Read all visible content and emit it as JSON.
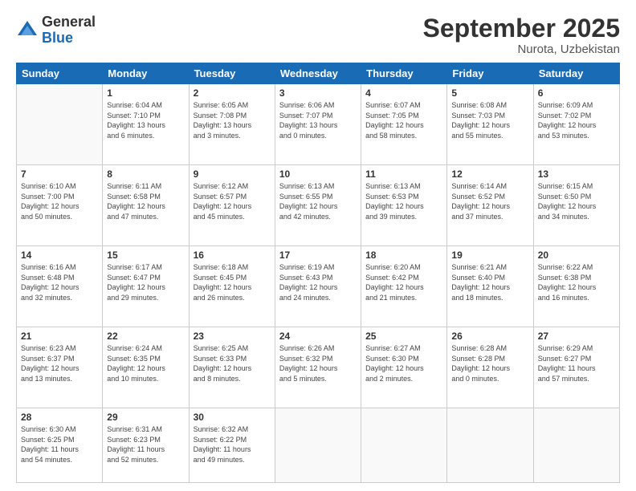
{
  "logo": {
    "general": "General",
    "blue": "Blue"
  },
  "header": {
    "month": "September 2025",
    "location": "Nurota, Uzbekistan"
  },
  "weekdays": [
    "Sunday",
    "Monday",
    "Tuesday",
    "Wednesday",
    "Thursday",
    "Friday",
    "Saturday"
  ],
  "weeks": [
    [
      {
        "day": "",
        "info": ""
      },
      {
        "day": "1",
        "info": "Sunrise: 6:04 AM\nSunset: 7:10 PM\nDaylight: 13 hours\nand 6 minutes."
      },
      {
        "day": "2",
        "info": "Sunrise: 6:05 AM\nSunset: 7:08 PM\nDaylight: 13 hours\nand 3 minutes."
      },
      {
        "day": "3",
        "info": "Sunrise: 6:06 AM\nSunset: 7:07 PM\nDaylight: 13 hours\nand 0 minutes."
      },
      {
        "day": "4",
        "info": "Sunrise: 6:07 AM\nSunset: 7:05 PM\nDaylight: 12 hours\nand 58 minutes."
      },
      {
        "day": "5",
        "info": "Sunrise: 6:08 AM\nSunset: 7:03 PM\nDaylight: 12 hours\nand 55 minutes."
      },
      {
        "day": "6",
        "info": "Sunrise: 6:09 AM\nSunset: 7:02 PM\nDaylight: 12 hours\nand 53 minutes."
      }
    ],
    [
      {
        "day": "7",
        "info": "Sunrise: 6:10 AM\nSunset: 7:00 PM\nDaylight: 12 hours\nand 50 minutes."
      },
      {
        "day": "8",
        "info": "Sunrise: 6:11 AM\nSunset: 6:58 PM\nDaylight: 12 hours\nand 47 minutes."
      },
      {
        "day": "9",
        "info": "Sunrise: 6:12 AM\nSunset: 6:57 PM\nDaylight: 12 hours\nand 45 minutes."
      },
      {
        "day": "10",
        "info": "Sunrise: 6:13 AM\nSunset: 6:55 PM\nDaylight: 12 hours\nand 42 minutes."
      },
      {
        "day": "11",
        "info": "Sunrise: 6:13 AM\nSunset: 6:53 PM\nDaylight: 12 hours\nand 39 minutes."
      },
      {
        "day": "12",
        "info": "Sunrise: 6:14 AM\nSunset: 6:52 PM\nDaylight: 12 hours\nand 37 minutes."
      },
      {
        "day": "13",
        "info": "Sunrise: 6:15 AM\nSunset: 6:50 PM\nDaylight: 12 hours\nand 34 minutes."
      }
    ],
    [
      {
        "day": "14",
        "info": "Sunrise: 6:16 AM\nSunset: 6:48 PM\nDaylight: 12 hours\nand 32 minutes."
      },
      {
        "day": "15",
        "info": "Sunrise: 6:17 AM\nSunset: 6:47 PM\nDaylight: 12 hours\nand 29 minutes."
      },
      {
        "day": "16",
        "info": "Sunrise: 6:18 AM\nSunset: 6:45 PM\nDaylight: 12 hours\nand 26 minutes."
      },
      {
        "day": "17",
        "info": "Sunrise: 6:19 AM\nSunset: 6:43 PM\nDaylight: 12 hours\nand 24 minutes."
      },
      {
        "day": "18",
        "info": "Sunrise: 6:20 AM\nSunset: 6:42 PM\nDaylight: 12 hours\nand 21 minutes."
      },
      {
        "day": "19",
        "info": "Sunrise: 6:21 AM\nSunset: 6:40 PM\nDaylight: 12 hours\nand 18 minutes."
      },
      {
        "day": "20",
        "info": "Sunrise: 6:22 AM\nSunset: 6:38 PM\nDaylight: 12 hours\nand 16 minutes."
      }
    ],
    [
      {
        "day": "21",
        "info": "Sunrise: 6:23 AM\nSunset: 6:37 PM\nDaylight: 12 hours\nand 13 minutes."
      },
      {
        "day": "22",
        "info": "Sunrise: 6:24 AM\nSunset: 6:35 PM\nDaylight: 12 hours\nand 10 minutes."
      },
      {
        "day": "23",
        "info": "Sunrise: 6:25 AM\nSunset: 6:33 PM\nDaylight: 12 hours\nand 8 minutes."
      },
      {
        "day": "24",
        "info": "Sunrise: 6:26 AM\nSunset: 6:32 PM\nDaylight: 12 hours\nand 5 minutes."
      },
      {
        "day": "25",
        "info": "Sunrise: 6:27 AM\nSunset: 6:30 PM\nDaylight: 12 hours\nand 2 minutes."
      },
      {
        "day": "26",
        "info": "Sunrise: 6:28 AM\nSunset: 6:28 PM\nDaylight: 12 hours\nand 0 minutes."
      },
      {
        "day": "27",
        "info": "Sunrise: 6:29 AM\nSunset: 6:27 PM\nDaylight: 11 hours\nand 57 minutes."
      }
    ],
    [
      {
        "day": "28",
        "info": "Sunrise: 6:30 AM\nSunset: 6:25 PM\nDaylight: 11 hours\nand 54 minutes."
      },
      {
        "day": "29",
        "info": "Sunrise: 6:31 AM\nSunset: 6:23 PM\nDaylight: 11 hours\nand 52 minutes."
      },
      {
        "day": "30",
        "info": "Sunrise: 6:32 AM\nSunset: 6:22 PM\nDaylight: 11 hours\nand 49 minutes."
      },
      {
        "day": "",
        "info": ""
      },
      {
        "day": "",
        "info": ""
      },
      {
        "day": "",
        "info": ""
      },
      {
        "day": "",
        "info": ""
      }
    ]
  ]
}
